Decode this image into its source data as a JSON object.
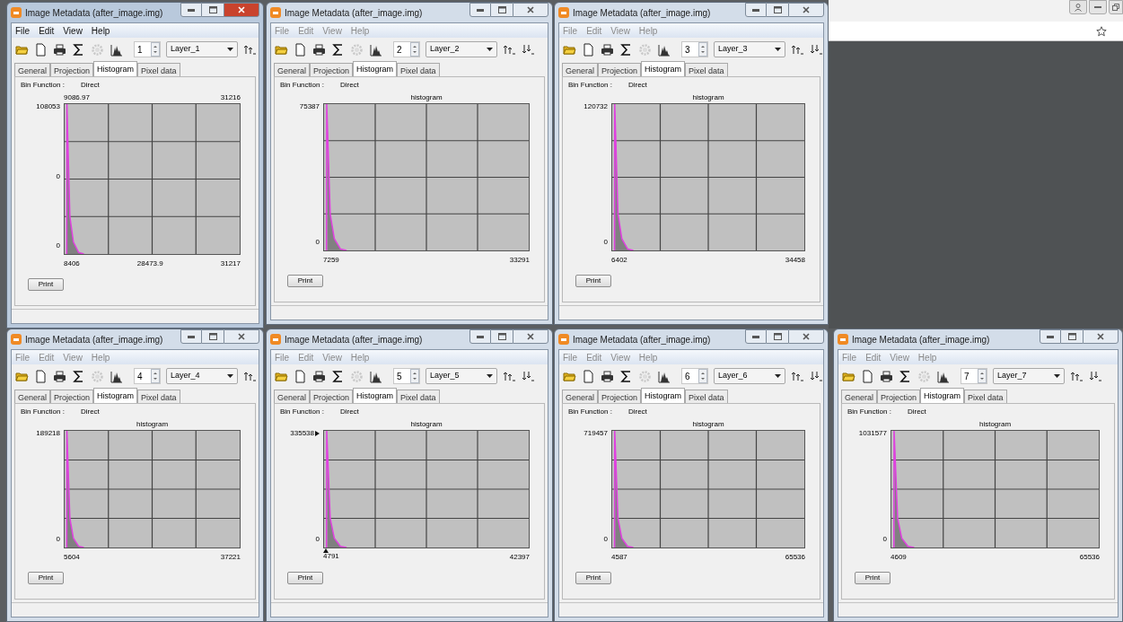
{
  "windows": [
    {
      "title": "Image Metadata (after_image.img)",
      "active": true,
      "menu": [
        "File",
        "Edit",
        "View",
        "Help"
      ],
      "band": "1",
      "layer": "Layer_1",
      "sort_icons": [
        {
          "kind": "ascending"
        }
      ],
      "tabs": [
        {
          "label": "General",
          "selected": false
        },
        {
          "label": "Projection",
          "selected": false
        },
        {
          "label": "Histogram",
          "selected": true
        },
        {
          "label": "Pixel data",
          "selected": false
        }
      ],
      "bin_label": "Bin Function :",
      "bin_value": "Direct",
      "top_labels": [
        "9086.97",
        "31216"
      ],
      "y_labels": [
        "108053",
        "0",
        "0"
      ],
      "x_labels": [
        "8406",
        "28473.9",
        "31217"
      ],
      "print": "Print",
      "markers": false
    },
    {
      "title": "Image Metadata (after_image.img)",
      "active": false,
      "menu": [
        "File",
        "Edit",
        "View",
        "Help"
      ],
      "band": "2",
      "layer": "Layer_2",
      "sort_icons": [
        {
          "kind": "ascending"
        },
        {
          "kind": "descending"
        }
      ],
      "tabs": [
        {
          "label": "General",
          "selected": false
        },
        {
          "label": "Projection",
          "selected": false
        },
        {
          "label": "Histogram",
          "selected": true
        },
        {
          "label": "Pixel data",
          "selected": false
        }
      ],
      "bin_label": "Bin Function :",
      "bin_value": "Direct",
      "chart_title": "histogram",
      "y_labels": [
        "75387",
        "0"
      ],
      "x_labels": [
        "7259",
        "33291"
      ],
      "print": "Print",
      "markers": false
    },
    {
      "title": "Image Metadata (after_image.img)",
      "active": false,
      "menu": [
        "File",
        "Edit",
        "View",
        "Help"
      ],
      "band": "3",
      "layer": "Layer_3",
      "sort_icons": [
        {
          "kind": "ascending"
        },
        {
          "kind": "descending"
        }
      ],
      "tabs": [
        {
          "label": "General",
          "selected": false
        },
        {
          "label": "Projection",
          "selected": false
        },
        {
          "label": "Histogram",
          "selected": true
        },
        {
          "label": "Pixel data",
          "selected": false
        }
      ],
      "bin_label": "Bin Function :",
      "bin_value": "Direct",
      "chart_title": "histogram",
      "y_labels": [
        "120732",
        "0"
      ],
      "x_labels": [
        "6402",
        "34458"
      ],
      "print": "Print",
      "markers": false
    },
    {
      "title": "Image Metadata (after_image.img)",
      "active": false,
      "menu": [
        "File",
        "Edit",
        "View",
        "Help"
      ],
      "band": "4",
      "layer": "Layer_4",
      "sort_icons": [
        {
          "kind": "ascending"
        }
      ],
      "tabs": [
        {
          "label": "General",
          "selected": false
        },
        {
          "label": "Projection",
          "selected": false
        },
        {
          "label": "Histogram",
          "selected": true
        },
        {
          "label": "Pixel data",
          "selected": false
        }
      ],
      "bin_label": "Bin Function :",
      "bin_value": "Direct",
      "chart_title": "histogram",
      "y_labels": [
        "189218",
        "0"
      ],
      "x_labels": [
        "5604",
        "37221"
      ],
      "print": "Print",
      "markers": false
    },
    {
      "title": "Image Metadata (after_image.img)",
      "active": false,
      "menu": [
        "File",
        "Edit",
        "View",
        "Help"
      ],
      "band": "5",
      "layer": "Layer_5",
      "sort_icons": [
        {
          "kind": "ascending"
        },
        {
          "kind": "descending"
        }
      ],
      "tabs": [
        {
          "label": "General",
          "selected": false
        },
        {
          "label": "Projection",
          "selected": false
        },
        {
          "label": "Histogram",
          "selected": true
        },
        {
          "label": "Pixel data",
          "selected": false
        }
      ],
      "bin_label": "Bin Function :",
      "bin_value": "Direct",
      "chart_title": "histogram",
      "y_labels": [
        "335538",
        "0"
      ],
      "x_labels": [
        "4791",
        "42397"
      ],
      "print": "Print",
      "markers": true
    },
    {
      "title": "Image Metadata (after_image.img)",
      "active": false,
      "menu": [
        "File",
        "Edit",
        "View",
        "Help"
      ],
      "band": "6",
      "layer": "Layer_6",
      "sort_icons": [
        {
          "kind": "ascending"
        },
        {
          "kind": "descending"
        }
      ],
      "tabs": [
        {
          "label": "General",
          "selected": false
        },
        {
          "label": "Projection",
          "selected": false
        },
        {
          "label": "Histogram",
          "selected": true
        },
        {
          "label": "Pixel data",
          "selected": false
        }
      ],
      "bin_label": "Bin Function :",
      "bin_value": "Direct",
      "chart_title": "histogram",
      "y_labels": [
        "719457",
        "0"
      ],
      "x_labels": [
        "4587",
        "65536"
      ],
      "print": "Print",
      "markers": false
    },
    {
      "title": "Image Metadata (after_image.img)",
      "active": false,
      "menu": [
        "File",
        "Edit",
        "View",
        "Help"
      ],
      "band": "7",
      "layer": "Layer_7",
      "sort_icons": [
        {
          "kind": "ascending"
        },
        {
          "kind": "descending"
        }
      ],
      "tabs": [
        {
          "label": "General",
          "selected": false
        },
        {
          "label": "Projection",
          "selected": false
        },
        {
          "label": "Histogram",
          "selected": true
        },
        {
          "label": "Pixel data",
          "selected": false
        }
      ],
      "bin_label": "Bin Function :",
      "bin_value": "Direct",
      "chart_title": "histogram",
      "y_labels": [
        "1031577",
        "0"
      ],
      "x_labels": [
        "4609",
        "65536"
      ],
      "print": "Print",
      "markers": false
    }
  ]
}
